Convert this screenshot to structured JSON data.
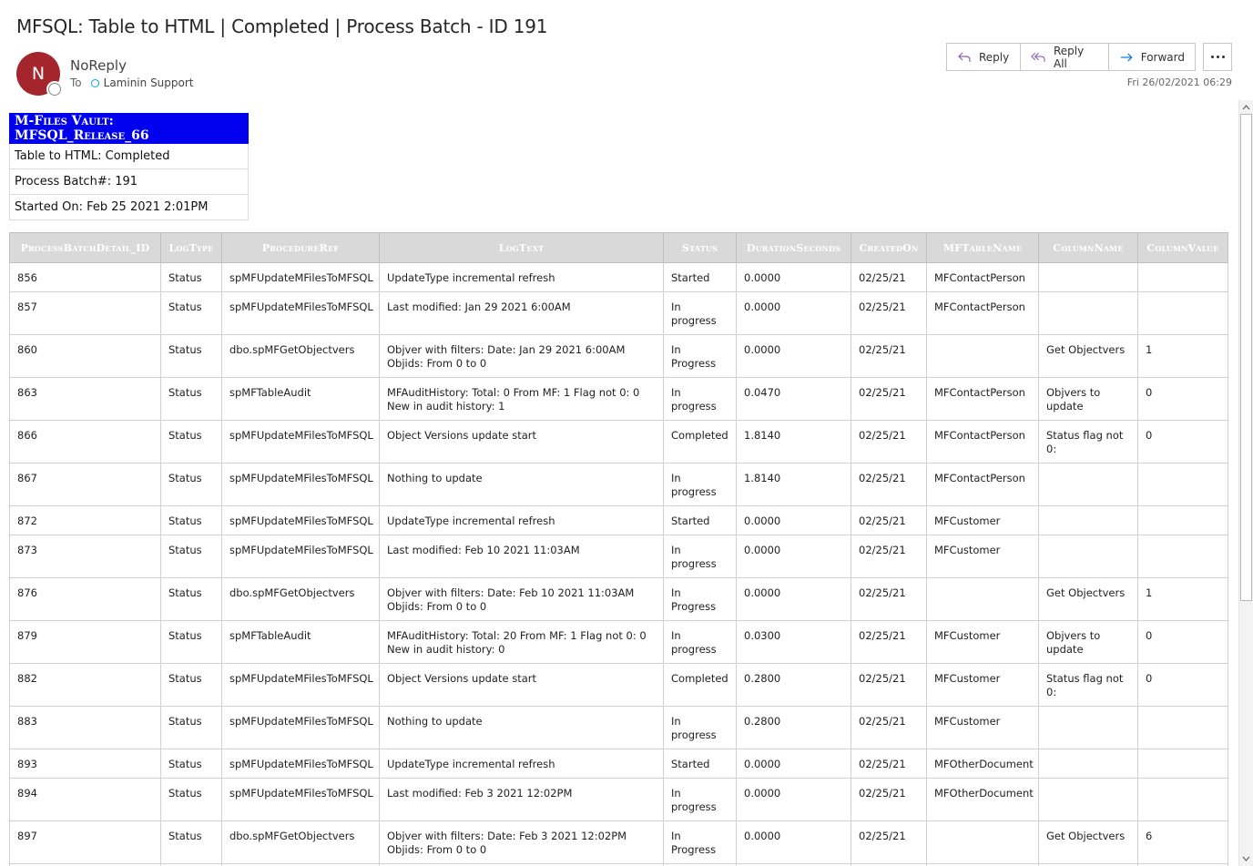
{
  "subject": "MFSQL: Table to HTML | Completed | Process Batch - ID 191",
  "sender": {
    "initial": "N",
    "name": "NoReply",
    "to_label": "To",
    "recipient": "Laminin Support",
    "avatar_color": "#a4262c"
  },
  "actions": {
    "reply": "Reply",
    "reply_all": "Reply All",
    "forward": "Forward",
    "more_icon": "more-icon"
  },
  "date": "Fri 26/02/2021 06:29",
  "summary": {
    "vault": "M-Files Vault: MFSQL_Release_66",
    "status": "Table to HTML: Completed",
    "batch": "Process Batch#: 191",
    "started": "Started On: Feb 25 2021 2:01PM",
    "header_color": "#0000ee"
  },
  "table": {
    "columns": [
      "ProcessBatchDetail_ID",
      "LogType",
      "ProcedureRef",
      "LogText",
      "Status",
      "DurationSeconds",
      "CreatedOn",
      "MFTableName",
      "ColumnName",
      "ColumnValue"
    ],
    "rows": [
      [
        "856",
        "Status",
        "spMFUpdateMFilesToMFSQL",
        "UpdateType incremental refresh",
        "Started",
        "0.0000",
        "02/25/21",
        "MFContactPerson",
        "",
        ""
      ],
      [
        "857",
        "Status",
        "spMFUpdateMFilesToMFSQL",
        "Last modified: Jan 29 2021 6:00AM",
        "In progress",
        "0.0000",
        "02/25/21",
        "MFContactPerson",
        "",
        ""
      ],
      [
        "860",
        "Status",
        "dbo.spMFGetObjectvers",
        "Objver with filters: Date: Jan 29 2021 6:00AM Objids: From 0 to 0",
        "In Progress",
        "0.0000",
        "02/25/21",
        "",
        "Get Objectvers",
        "1"
      ],
      [
        "863",
        "Status",
        "spMFTableAudit",
        "MFAuditHistory: Total: 0 From MF: 1 Flag not 0: 0 New in audit history: 1",
        "In progress",
        "0.0470",
        "02/25/21",
        "MFContactPerson",
        "Objvers to update",
        "0"
      ],
      [
        "866",
        "Status",
        "spMFUpdateMFilesToMFSQL",
        "Object Versions update start",
        "Completed",
        "1.8140",
        "02/25/21",
        "MFContactPerson",
        "Status flag not 0:",
        "0"
      ],
      [
        "867",
        "Status",
        "spMFUpdateMFilesToMFSQL",
        "Nothing to update",
        "In progress",
        "1.8140",
        "02/25/21",
        "MFContactPerson",
        "",
        ""
      ],
      [
        "872",
        "Status",
        "spMFUpdateMFilesToMFSQL",
        "UpdateType incremental refresh",
        "Started",
        "0.0000",
        "02/25/21",
        "MFCustomer",
        "",
        ""
      ],
      [
        "873",
        "Status",
        "spMFUpdateMFilesToMFSQL",
        "Last modified: Feb 10 2021 11:03AM",
        "In progress",
        "0.0000",
        "02/25/21",
        "MFCustomer",
        "",
        ""
      ],
      [
        "876",
        "Status",
        "dbo.spMFGetObjectvers",
        "Objver with filters: Date: Feb 10 2021 11:03AM Objids: From 0 to 0",
        "In Progress",
        "0.0000",
        "02/25/21",
        "",
        "Get Objectvers",
        "1"
      ],
      [
        "879",
        "Status",
        "spMFTableAudit",
        "MFAuditHistory: Total: 20 From MF: 1 Flag not 0: 0 New in audit history: 0",
        "In progress",
        "0.0300",
        "02/25/21",
        "MFCustomer",
        "Objvers to update",
        "0"
      ],
      [
        "882",
        "Status",
        "spMFUpdateMFilesToMFSQL",
        "Object Versions update start",
        "Completed",
        "0.2800",
        "02/25/21",
        "MFCustomer",
        "Status flag not 0:",
        "0"
      ],
      [
        "883",
        "Status",
        "spMFUpdateMFilesToMFSQL",
        "Nothing to update",
        "In progress",
        "0.2800",
        "02/25/21",
        "MFCustomer",
        "",
        ""
      ],
      [
        "893",
        "Status",
        "spMFUpdateMFilesToMFSQL",
        "UpdateType incremental refresh",
        "Started",
        "0.0000",
        "02/25/21",
        "MFOtherDocument",
        "",
        ""
      ],
      [
        "894",
        "Status",
        "spMFUpdateMFilesToMFSQL",
        "Last modified: Feb 3 2021 12:02PM",
        "In progress",
        "0.0000",
        "02/25/21",
        "MFOtherDocument",
        "",
        ""
      ],
      [
        "897",
        "Status",
        "dbo.spMFGetObjectvers",
        "Objver with filters: Date: Feb 3 2021 12:02PM Objids: From 0 to 0",
        "In Progress",
        "0.0000",
        "02/25/21",
        "",
        "Get Objectvers",
        "6"
      ],
      [
        "",
        "",
        "",
        "",
        "",
        "",
        "",
        "",
        "",
        ""
      ]
    ]
  }
}
